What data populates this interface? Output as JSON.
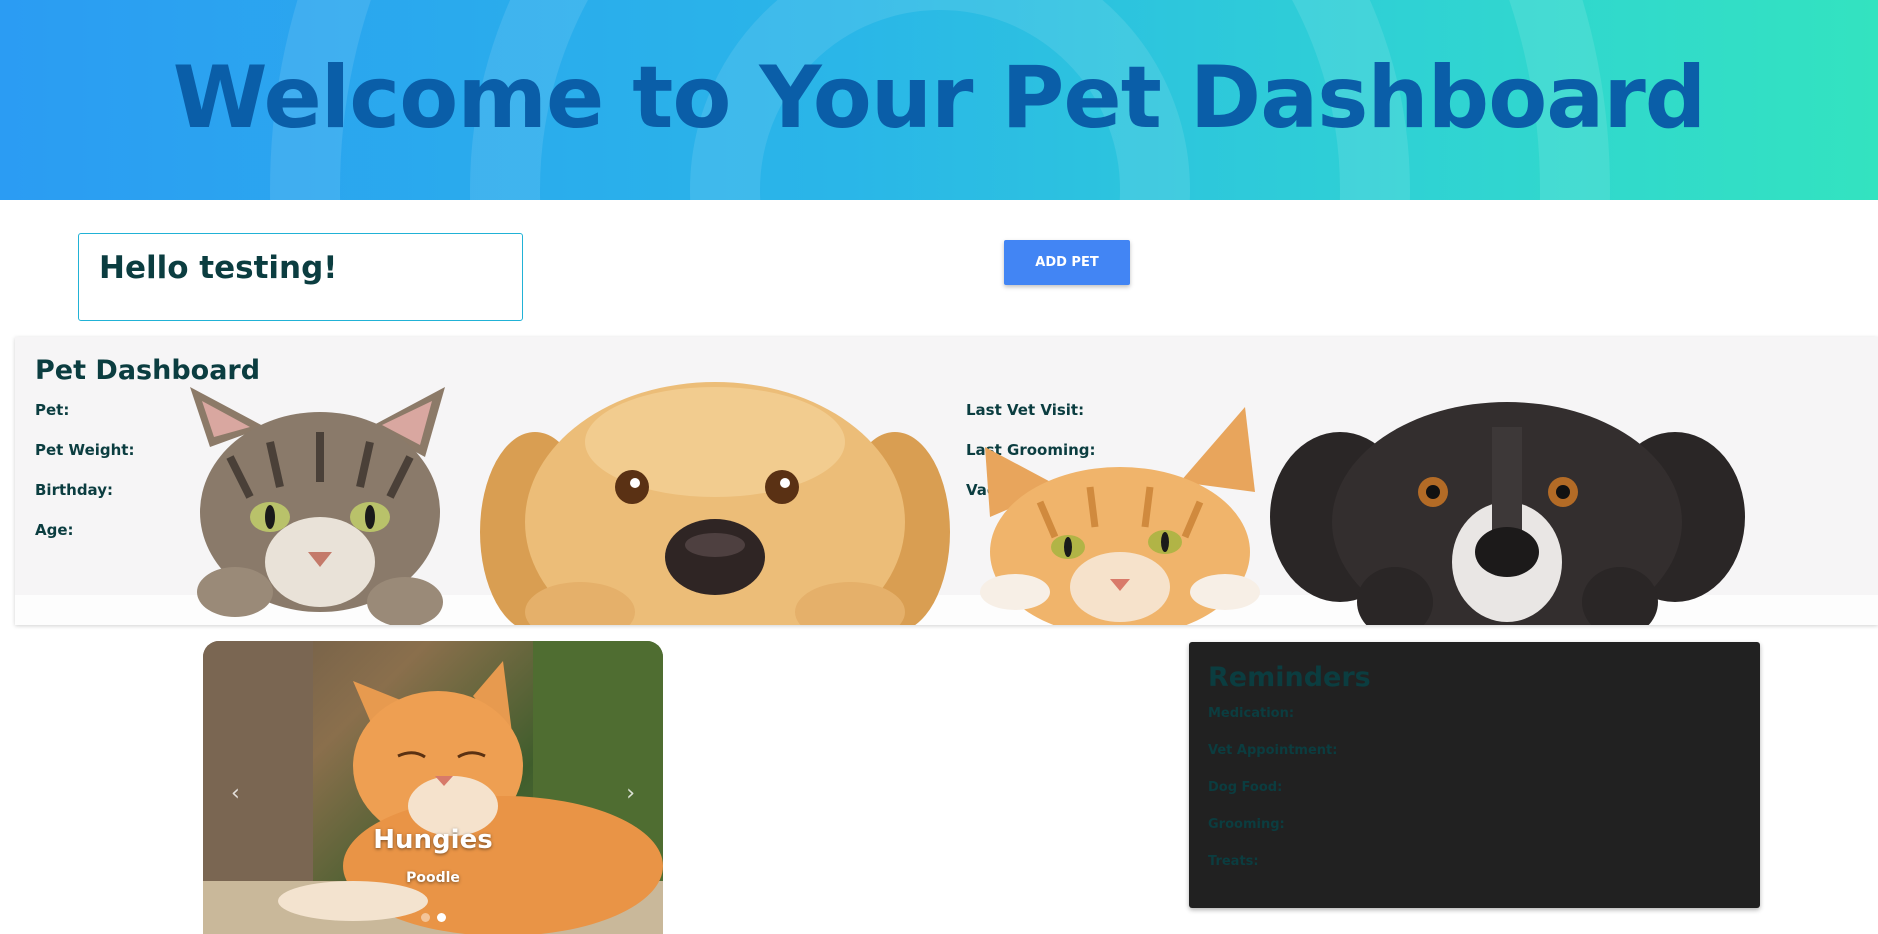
{
  "header": {
    "title": "Welcome to Your Pet Dashboard"
  },
  "greeting": {
    "text": "Hello testing!"
  },
  "actions": {
    "add_pet_label": "ADD PET"
  },
  "dashboard": {
    "title": "Pet Dashboard",
    "left_fields": [
      "Pet:",
      "Pet Weight:",
      "Birthday:",
      "Age:"
    ],
    "right_fields": [
      "Last Vet Visit:",
      "Last Grooming:",
      "Vaccines:"
    ]
  },
  "carousel": {
    "name": "Hungies",
    "breed": "Poodle",
    "prev_icon": "chevron-left-icon",
    "next_icon": "chevron-right-icon",
    "slides": 2,
    "active_slide": 2
  },
  "reminders": {
    "title": "Reminders",
    "fields": [
      "Medication:",
      "Vet Appointment:",
      "Dog Food:",
      "Grooming:",
      "Treats:"
    ]
  },
  "colors": {
    "header_gradient_start": "#2b9cf3",
    "header_gradient_end": "#33e3c0",
    "title_blue": "#0a5ea8",
    "text_dark_teal": "#0b3d40",
    "button_blue": "#4285f4",
    "reminders_bg": "#212121"
  }
}
